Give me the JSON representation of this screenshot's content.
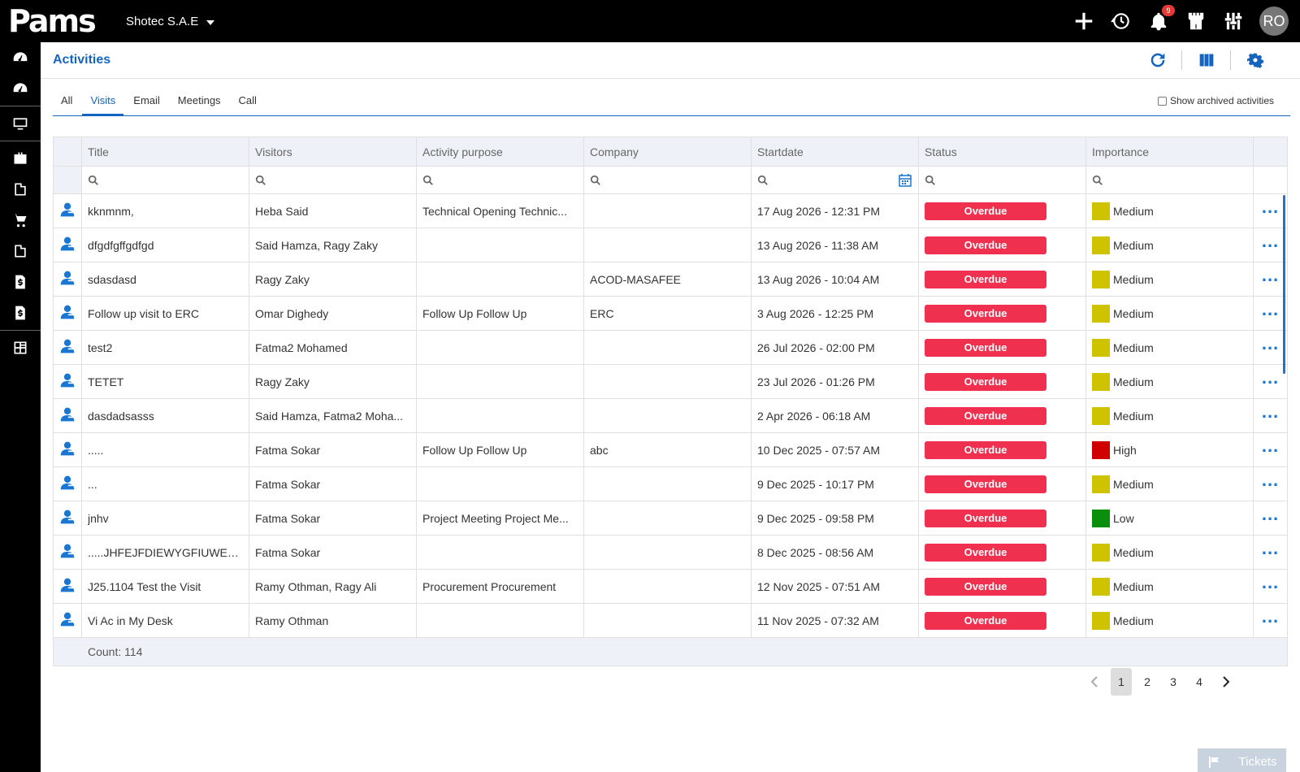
{
  "app": {
    "logo_text": "Pams",
    "company": "Shotec S.A.E",
    "notification_count": "9",
    "user_initials": "RO"
  },
  "page": {
    "title": "Activities"
  },
  "tabs": [
    {
      "label": "All",
      "active": false
    },
    {
      "label": "Visits",
      "active": true
    },
    {
      "label": "Email",
      "active": false
    },
    {
      "label": "Meetings",
      "active": false
    },
    {
      "label": "Call",
      "active": false
    }
  ],
  "show_archived_label": "Show archived activities",
  "columns": [
    "Title",
    "Visitors",
    "Activity purpose",
    "Company",
    "Startdate",
    "Status",
    "Importance"
  ],
  "importance_colors": {
    "Medium": "#cfc300",
    "High": "#d00000",
    "Low": "#0a8f0a"
  },
  "status_color": "#f0304f",
  "rows": [
    {
      "title": "kknmnm,",
      "visitors": "Heba Said",
      "purpose": "Technical Opening Technic...",
      "company": "",
      "startdate": "17 Aug 2026 - 12:31 PM",
      "status": "Overdue",
      "importance": "Medium"
    },
    {
      "title": "dfgdfgffgdfgd",
      "visitors": "Said Hamza, Ragy Zaky",
      "purpose": "",
      "company": "",
      "startdate": "13 Aug 2026 - 11:38 AM",
      "status": "Overdue",
      "importance": "Medium"
    },
    {
      "title": "sdasdasd",
      "visitors": "Ragy Zaky",
      "purpose": "",
      "company": "ACOD-MASAFEE",
      "startdate": "13 Aug 2026 - 10:04 AM",
      "status": "Overdue",
      "importance": "Medium"
    },
    {
      "title": "Follow up visit to ERC",
      "visitors": "Omar Dighedy",
      "purpose": "Follow Up Follow Up",
      "company": "ERC",
      "startdate": "3 Aug 2026 - 12:25 PM",
      "status": "Overdue",
      "importance": "Medium"
    },
    {
      "title": "test2",
      "visitors": "Fatma2 Mohamed",
      "purpose": "",
      "company": "",
      "startdate": "26 Jul 2026 - 02:00 PM",
      "status": "Overdue",
      "importance": "Medium"
    },
    {
      "title": "TETET",
      "visitors": "Ragy Zaky",
      "purpose": "",
      "company": "",
      "startdate": "23 Jul 2026 - 01:26 PM",
      "status": "Overdue",
      "importance": "Medium"
    },
    {
      "title": "dasdadsasss",
      "visitors": "Said Hamza, Fatma2 Moha...",
      "purpose": "",
      "company": "",
      "startdate": "2 Apr 2026 - 06:18 AM",
      "status": "Overdue",
      "importance": "Medium"
    },
    {
      "title": ".....",
      "visitors": "Fatma Sokar",
      "purpose": "Follow Up Follow Up",
      "company": "abc",
      "startdate": "10 Dec 2025 - 07:57 AM",
      "status": "Overdue",
      "importance": "High"
    },
    {
      "title": "...",
      "visitors": "Fatma Sokar",
      "purpose": "",
      "company": "",
      "startdate": "9 Dec 2025 - 10:17 PM",
      "status": "Overdue",
      "importance": "Medium"
    },
    {
      "title": "jnhv",
      "visitors": "Fatma Sokar",
      "purpose": "Project Meeting Project Me...",
      "company": "",
      "startdate": "9 Dec 2025 - 09:58 PM",
      "status": "Overdue",
      "importance": "Low"
    },
    {
      "title": ".....JHFEJFDIEWYGFIUWEGK...",
      "visitors": "Fatma Sokar",
      "purpose": "",
      "company": "",
      "startdate": "8 Dec 2025 - 08:56 AM",
      "status": "Overdue",
      "importance": "Medium"
    },
    {
      "title": "J25.1104 Test the Visit",
      "visitors": "Ramy Othman, Ragy Ali",
      "purpose": "Procurement Procurement",
      "company": "",
      "startdate": "12 Nov 2025 - 07:51 AM",
      "status": "Overdue",
      "importance": "Medium"
    },
    {
      "title": "Vi Ac in My Desk",
      "visitors": "Ramy Othman",
      "purpose": "",
      "company": "",
      "startdate": "11 Nov 2025 - 07:32 AM",
      "status": "Overdue",
      "importance": "Medium"
    }
  ],
  "count_label": "Count: 114",
  "pagination": {
    "pages": [
      "1",
      "2",
      "3",
      "4"
    ],
    "current": "1"
  },
  "tickets_label": "Tickets"
}
